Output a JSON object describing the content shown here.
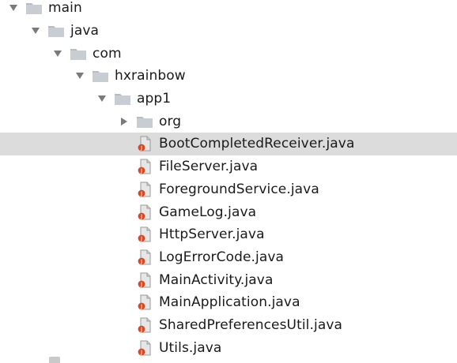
{
  "tree": {
    "folders": [
      {
        "label": "main",
        "expanded": true
      },
      {
        "label": "java",
        "expanded": true
      },
      {
        "label": "com",
        "expanded": true
      },
      {
        "label": "hxrainbow",
        "expanded": true
      },
      {
        "label": "app1",
        "expanded": true
      },
      {
        "label": "org",
        "expanded": false
      }
    ],
    "files": [
      {
        "label": "BootCompletedReceiver.java",
        "selected": true
      },
      {
        "label": "FileServer.java",
        "selected": false
      },
      {
        "label": "ForegroundService.java",
        "selected": false
      },
      {
        "label": "GameLog.java",
        "selected": false
      },
      {
        "label": "HttpServer.java",
        "selected": false
      },
      {
        "label": "LogErrorCode.java",
        "selected": false
      },
      {
        "label": "MainActivity.java",
        "selected": false
      },
      {
        "label": "MainApplication.java",
        "selected": false
      },
      {
        "label": "SharedPreferencesUtil.java",
        "selected": false
      },
      {
        "label": "Utils.java",
        "selected": false
      }
    ]
  },
  "colors": {
    "folder": "#c8cdd3",
    "folder_tab": "#b6bcc4",
    "selection": "#dcdcdc",
    "java_badge": "#d9481f",
    "arrow": "#7a7a7a"
  },
  "icons": {
    "expanded_arrow": "triangle-down-icon",
    "collapsed_arrow": "triangle-right-icon",
    "folder": "folder-icon",
    "java_file": "java-file-icon"
  }
}
